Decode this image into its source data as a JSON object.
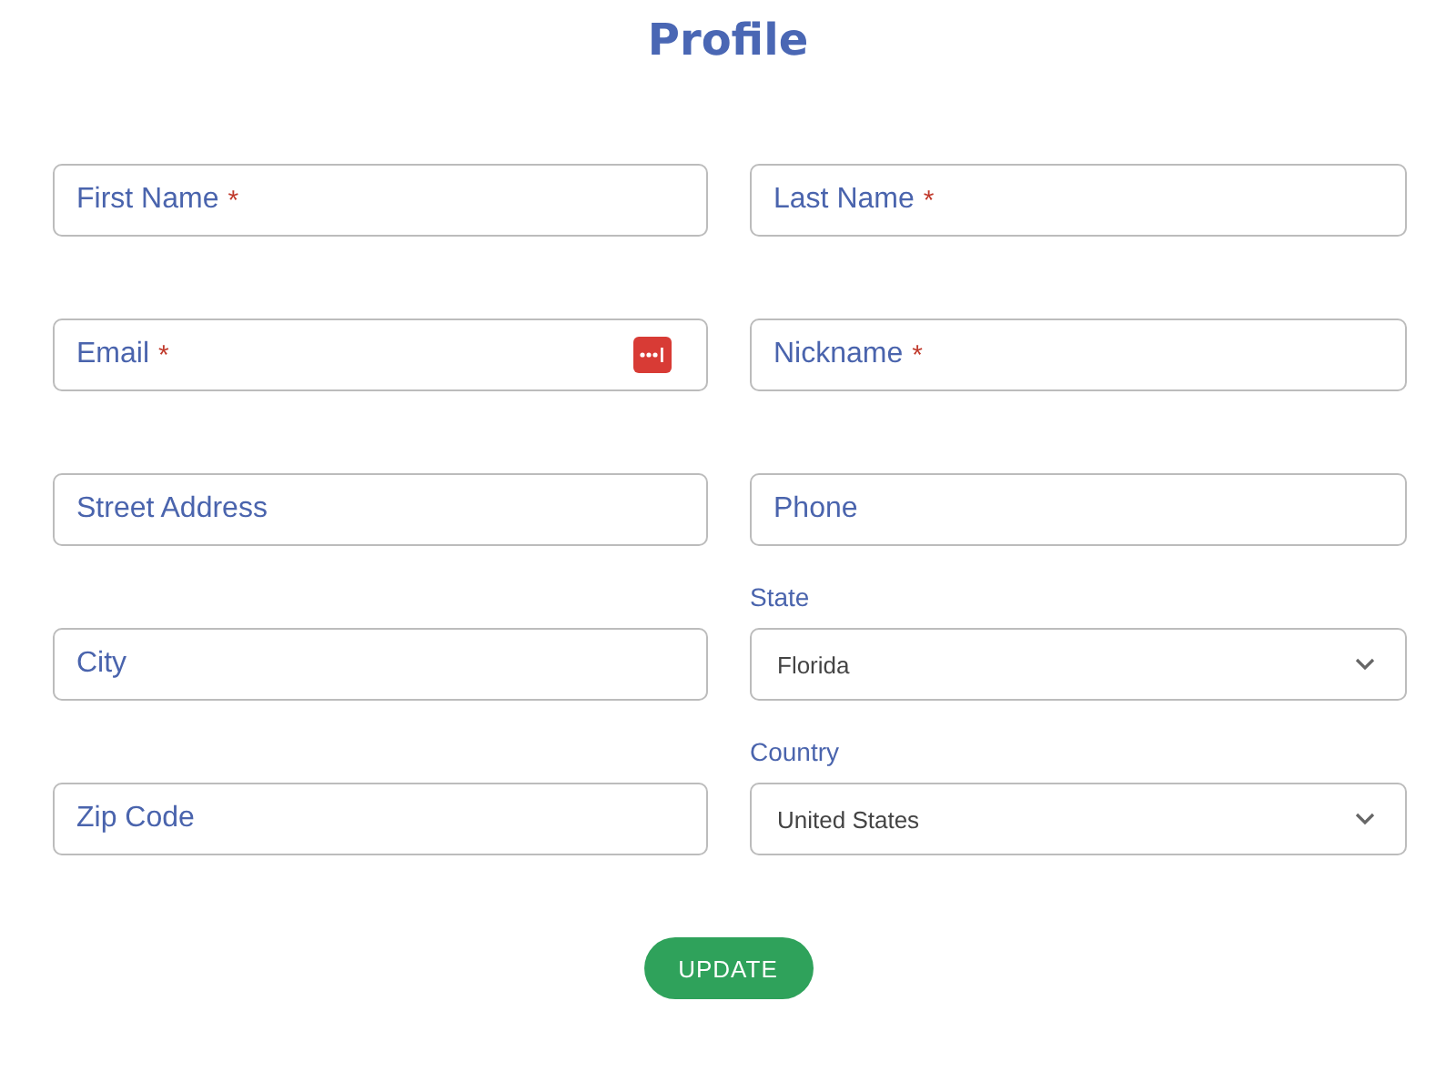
{
  "title": "Profile",
  "fields": [
    {
      "kind": "text",
      "placeholder": "First Name",
      "required_mark": "*"
    },
    {
      "kind": "text",
      "placeholder": "Last Name",
      "required_mark": "*"
    },
    {
      "kind": "text",
      "placeholder": "Email",
      "required_mark": "*",
      "autofill_icon": true
    },
    {
      "kind": "text",
      "placeholder": "Nickname",
      "required_mark": "*"
    },
    {
      "kind": "text",
      "placeholder": "Street Address"
    },
    {
      "kind": "text",
      "placeholder": "Phone"
    },
    {
      "kind": "text",
      "placeholder": "City"
    },
    {
      "kind": "select",
      "label": "State",
      "value": "Florida"
    },
    {
      "kind": "text",
      "placeholder": "Zip Code"
    },
    {
      "kind": "select",
      "label": "Country",
      "value": "United States"
    }
  ],
  "button": "UPDATE"
}
